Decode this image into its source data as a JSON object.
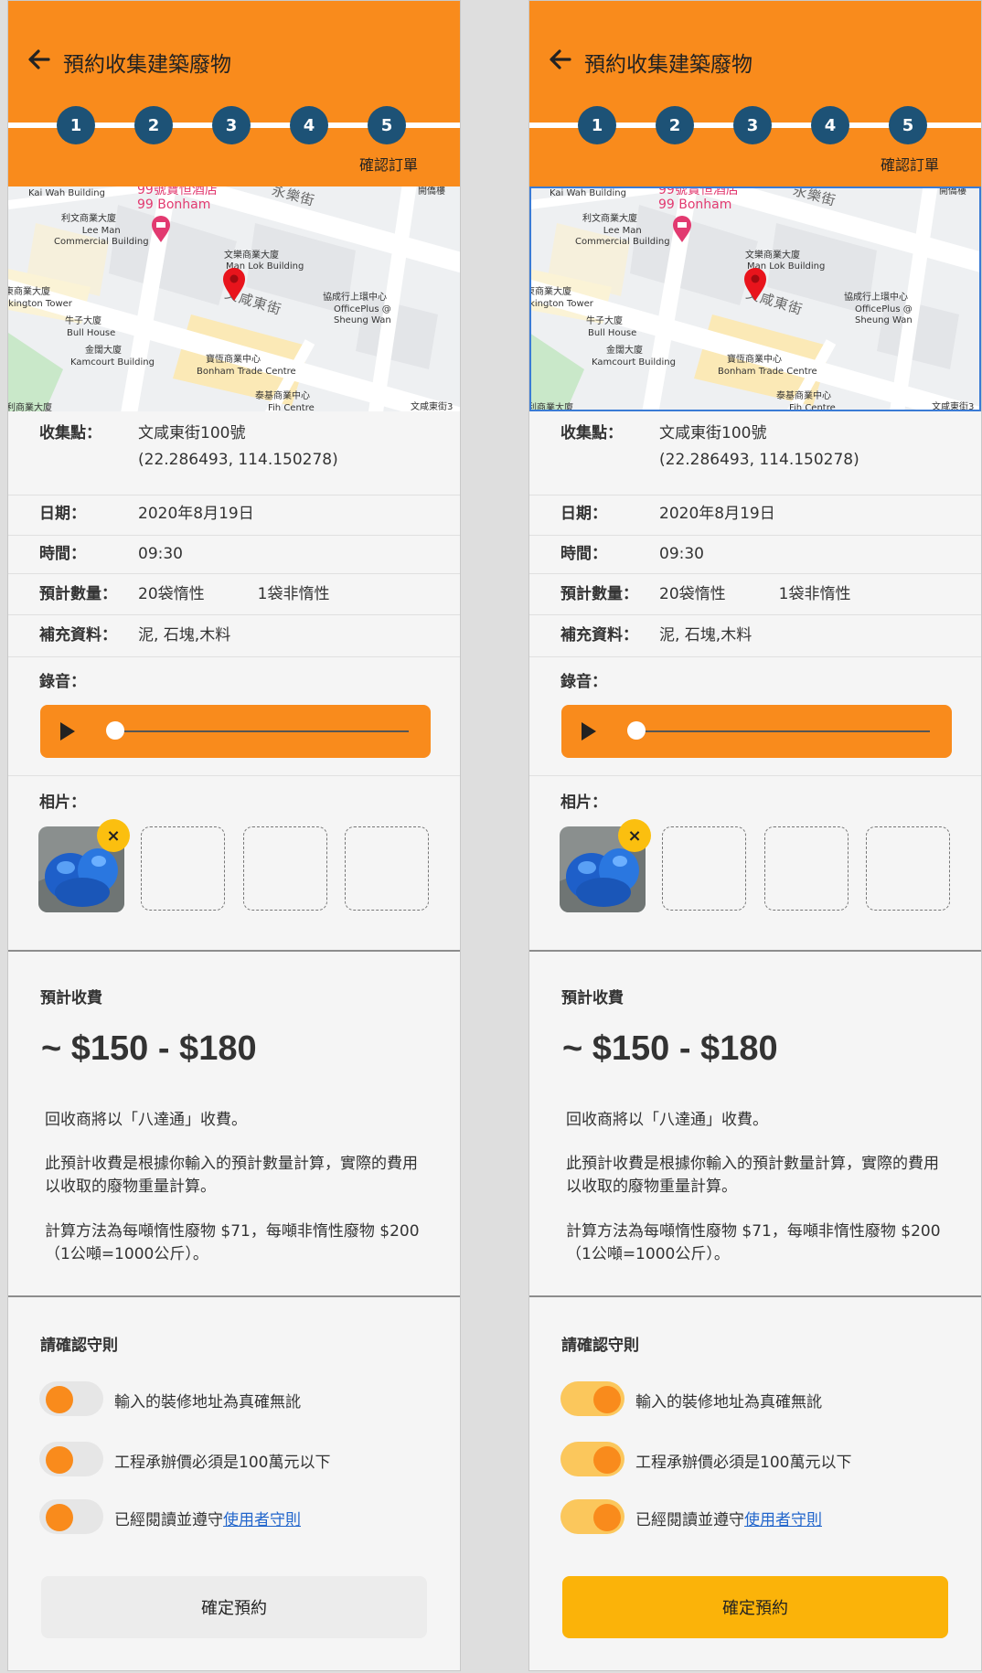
{
  "header": {
    "title": "預約收集建築廢物",
    "steps": [
      "1",
      "2",
      "3",
      "4",
      "5"
    ],
    "step_label": "確認訂單"
  },
  "map": {
    "labels": {
      "kai_wah": "Kai Wah Building",
      "hotel_cn": "99號寶恒酒店",
      "hotel_en": "99 Bonham",
      "wing_lok": "永樂街",
      "hoi_kung": "開僑樓",
      "lee_man_cn": "利文商業大廈",
      "lee_man_en": "Lee Man\nCommercial Building",
      "man_lok_cn": "文樂商業大廈",
      "man_lok_en": "Man Lok Building",
      "hip_shing_cn": "協成行上環中心",
      "hip_shing_en": "OfficePlus @\nSheung Wan",
      "harkington_cn": "東商業大廈",
      "harkington_en": "rkington Tower",
      "man_hai": "文咸東街",
      "bull_cn": "牛子大廈",
      "bull_en": "Bull House",
      "kamcourt_cn": "金闊大廈",
      "kamcourt_en": "Kamcourt Building",
      "bonham_cn": "寶恆商業中心",
      "bonham_en": "Bonham Trade Centre",
      "tai_fat_cn": "泰基商業中心",
      "tai_fat_en": "Fih Centre",
      "man_hai_2": "文咸東街3",
      "bottom_left": "利商業大廈"
    }
  },
  "details": {
    "location_label": "收集點：",
    "location_value": "文咸東街100號",
    "location_coords": "(22.286493, 114.150278)",
    "date_label": "日期：",
    "date_value": "2020年8月19日",
    "time_label": "時間：",
    "time_value": "09:30",
    "qty_label": "預計數量：",
    "qty_inert": "20袋惰性",
    "qty_noninert": "1袋非惰性",
    "extra_label": "補充資料：",
    "extra_value": "泥, 石塊,木料",
    "recording_label": "錄音：",
    "photos_label": "相片：",
    "remove_icon": "×"
  },
  "fee": {
    "title": "預計收費",
    "amount": "~ $150 - $180",
    "p1": "回收商將以「八達通」收費。",
    "p2": "此預計收費是根據你輸入的預計數量計算，實際的費用以收取的廢物重量計算。",
    "p3": "計算方法為每噸惰性廢物 $71，每噸非惰性廢物 $200（1公噸=1000公斤）。"
  },
  "rules": {
    "title": "請確認守則",
    "r1": "輸入的裝修地址為真確無訛",
    "r2": "工程承辦價必須是100萬元以下",
    "r3_prefix": "已經閱讀並遵守",
    "r3_link": "使用者守則"
  },
  "confirm_label": "確定預約",
  "colors": {
    "header": "#f98b1c",
    "step": "#1d5276",
    "accent_yellow": "#fbb309",
    "link": "#2266cc"
  }
}
